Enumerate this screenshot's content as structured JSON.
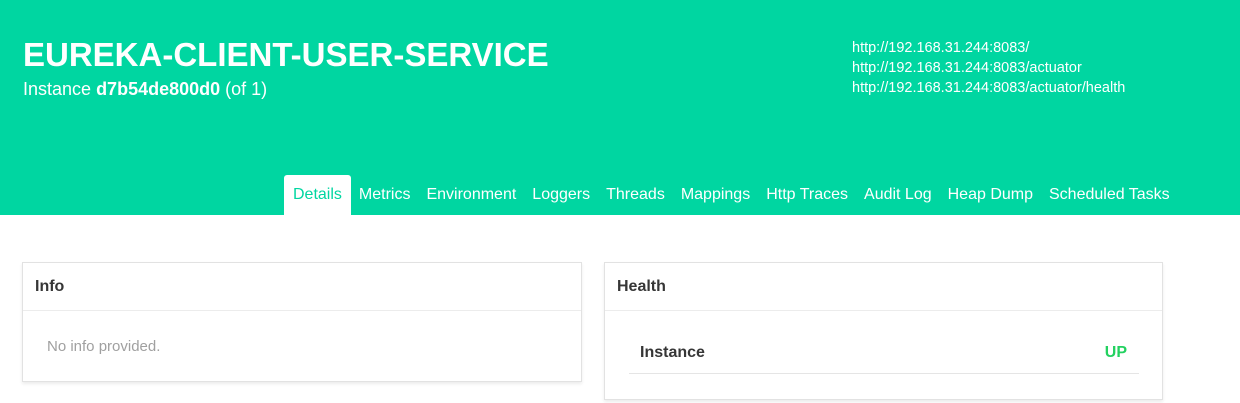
{
  "header": {
    "title": "EUREKA-CLIENT-USER-SERVICE",
    "instance_prefix": "Instance",
    "instance_id": "d7b54de800d0",
    "instance_count": "(of 1)",
    "links": [
      "http://192.168.31.244:8083/",
      "http://192.168.31.244:8083/actuator",
      "http://192.168.31.244:8083/actuator/health"
    ]
  },
  "tabs": [
    {
      "label": "Details",
      "active": true
    },
    {
      "label": "Metrics"
    },
    {
      "label": "Environment"
    },
    {
      "label": "Loggers"
    },
    {
      "label": "Threads"
    },
    {
      "label": "Mappings"
    },
    {
      "label": "Http Traces"
    },
    {
      "label": "Audit Log"
    },
    {
      "label": "Heap Dump"
    },
    {
      "label": "Scheduled Tasks"
    }
  ],
  "info": {
    "title": "Info",
    "empty_text": "No info provided."
  },
  "health": {
    "title": "Health",
    "rows": [
      {
        "name": "Instance",
        "status": "UP"
      }
    ]
  },
  "colors": {
    "brand": "#00d6a1",
    "status_up": "#23d160"
  }
}
